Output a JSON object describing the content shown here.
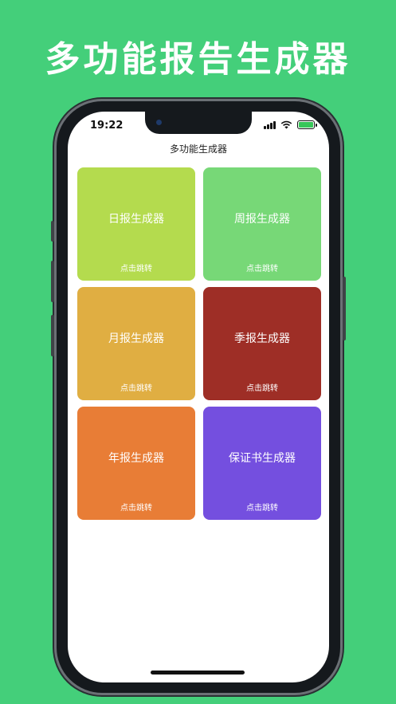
{
  "banner_title": "多功能报告生成器",
  "status_bar": {
    "time": "19:22"
  },
  "nav": {
    "title": "多功能生成器"
  },
  "cards": [
    {
      "title": "日报生成器",
      "subtitle": "点击跳转",
      "color": "#b4db4e"
    },
    {
      "title": "周报生成器",
      "subtitle": "点击跳转",
      "color": "#77d877"
    },
    {
      "title": "月报生成器",
      "subtitle": "点击跳转",
      "color": "#e0ae42"
    },
    {
      "title": "季报生成器",
      "subtitle": "点击跳转",
      "color": "#9e2e26"
    },
    {
      "title": "年报生成器",
      "subtitle": "点击跳转",
      "color": "#e87d36"
    },
    {
      "title": "保证书生成器",
      "subtitle": "点击跳转",
      "color": "#744fdf"
    }
  ],
  "colors": {
    "background": "#44cf7a",
    "phone_frame": "#15191d"
  }
}
